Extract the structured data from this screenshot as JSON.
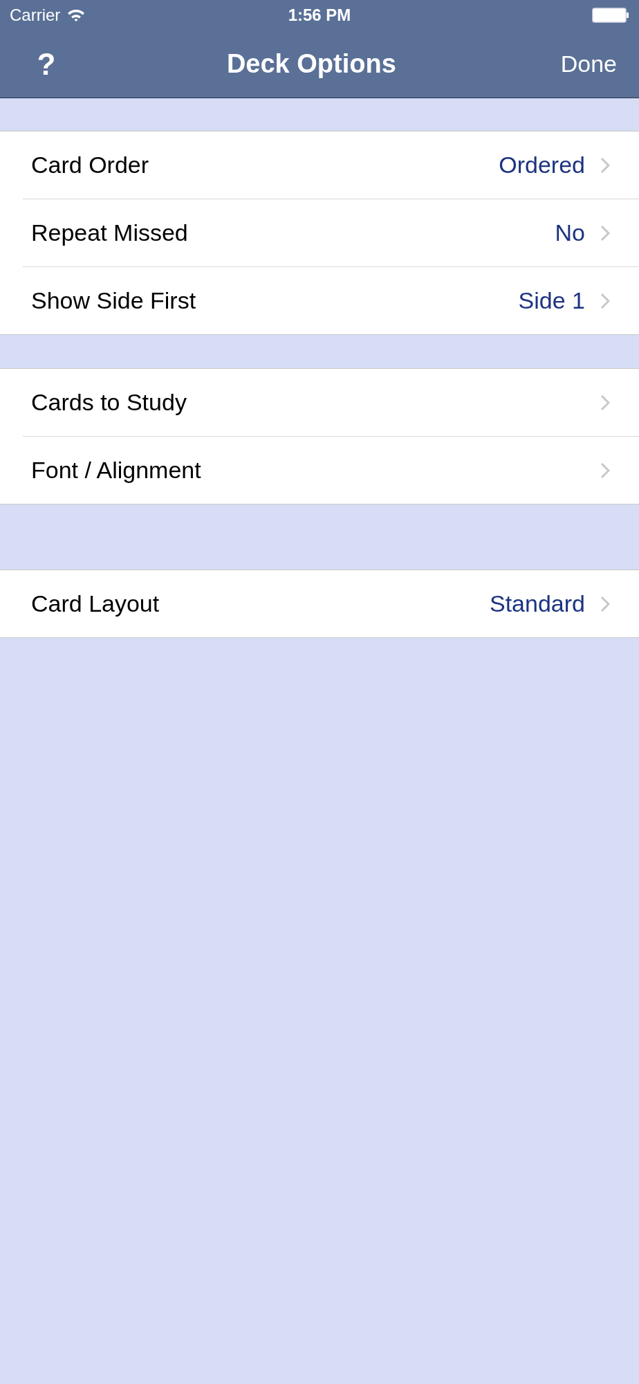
{
  "status_bar": {
    "carrier": "Carrier",
    "time": "1:56 PM"
  },
  "nav_bar": {
    "left_button": "?",
    "title": "Deck Options",
    "right_button": "Done"
  },
  "groups": [
    {
      "rows": [
        {
          "label": "Card Order",
          "value": "Ordered"
        },
        {
          "label": "Repeat Missed",
          "value": "No"
        },
        {
          "label": "Show Side First",
          "value": "Side 1"
        }
      ]
    },
    {
      "rows": [
        {
          "label": "Cards to Study"
        },
        {
          "label": "Font / Alignment"
        }
      ]
    },
    {
      "rows": [
        {
          "label": "Card Layout",
          "value": "Standard"
        }
      ]
    }
  ]
}
